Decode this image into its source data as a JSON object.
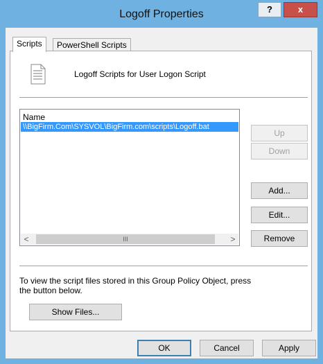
{
  "window": {
    "title": "Logoff Properties",
    "help_label": "?",
    "close_label": "x"
  },
  "tabs": [
    {
      "label": "Scripts",
      "active": true
    },
    {
      "label": "PowerShell Scripts",
      "active": false
    }
  ],
  "scripts_panel": {
    "heading": "Logoff Scripts for User Logon Script",
    "list": {
      "column_header": "Name",
      "rows": [
        "\\\\BigFirm.Com\\SYSVOL\\BigFirm.com\\scripts\\Logoff.bat"
      ],
      "scrollbar": {
        "left": "<",
        "thumb": "III",
        "right": ">"
      }
    },
    "buttons": {
      "up": "Up",
      "down": "Down",
      "add": "Add...",
      "edit": "Edit...",
      "remove": "Remove"
    },
    "info_text": "To view the script files stored in this Group Policy Object, press the button below.",
    "show_files": "Show Files..."
  },
  "footer": {
    "ok": "OK",
    "cancel": "Cancel",
    "apply": "Apply"
  },
  "icons": {
    "script_icon": "script-file-icon"
  }
}
